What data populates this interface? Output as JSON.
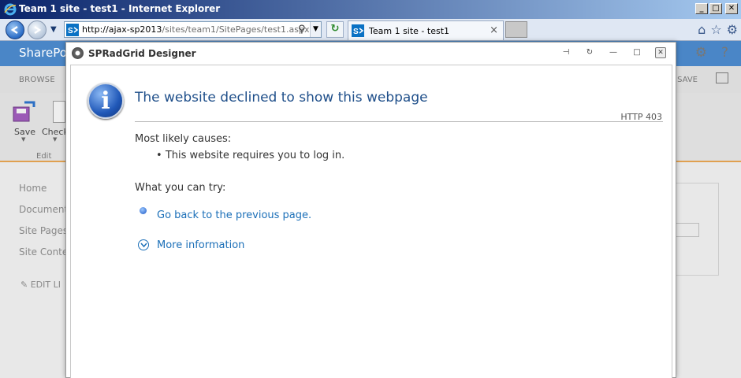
{
  "window": {
    "title": "Team 1 site - test1 - Internet Explorer",
    "buttons": {
      "minimize": "_",
      "maximize": "□",
      "close": "✕"
    }
  },
  "nav": {
    "url_host": "http://ajax-sp2013",
    "url_path": "/sites/team1/SitePages/test1.aspx",
    "tab_title": "Team 1 site - test1",
    "tab_close": "×"
  },
  "sharepoint": {
    "brand": "SharePo",
    "ribbon_tab": "BROWSE",
    "ribbon_right": "SAVE",
    "tools": {
      "save": "Save",
      "check": "Check",
      "group": "Edit"
    },
    "nav_items": [
      "Home",
      "Document",
      "Site Pages",
      "Site Conte"
    ],
    "edit_links": "EDIT LI"
  },
  "dialog": {
    "title": "SPRadGrid Designer",
    "error_title": "The website declined to show this webpage",
    "http_code": "HTTP 403",
    "causes_heading": "Most likely causes:",
    "cause_1": "This website requires you to log in.",
    "try_heading": "What you can try:",
    "go_back": "Go back to the previous page.",
    "more_info": "More information"
  }
}
